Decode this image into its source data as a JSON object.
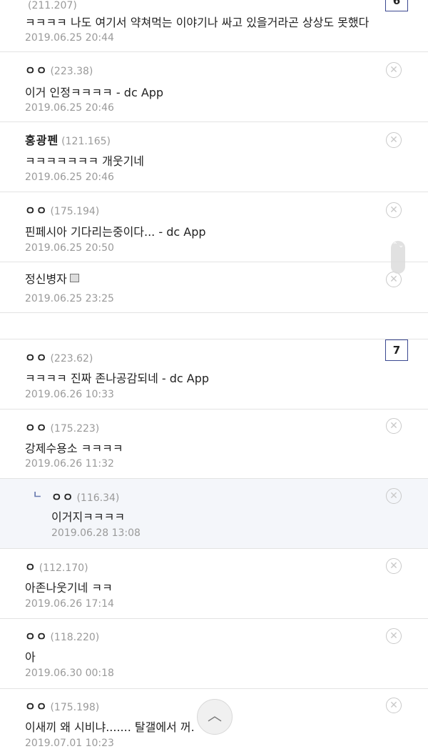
{
  "top_partial": {
    "ip": "(211.207)",
    "text": "ㅋㅋㅋㅋ 나도 여기서 약쳐먹는 이야기나 싸고 있을거라곤 상상도 못했다",
    "date": "2019.06.25 20:44",
    "page_badge": "6"
  },
  "comments": [
    {
      "nick": "ㅇㅇ",
      "ip": "(223.38)",
      "text": "이거 인정ㅋㅋㅋㅋ - dc App",
      "date": "2019.06.25 20:46"
    },
    {
      "nick": "홍광펜",
      "ip": "(121.165)",
      "text": "ㅋㅋㅋㅋㅋㅋㅋ 개웃기네",
      "date": "2019.06.25 20:46"
    },
    {
      "nick": "ㅇㅇ",
      "ip": "(175.194)",
      "text": "핀페시아 기다리는중이다... - dc App",
      "date": "2019.06.25 20:50"
    },
    {
      "nick": "정신병자",
      "ip": "",
      "text": "",
      "date": "2019.06.25 23:25"
    }
  ],
  "page_badge_2": "7",
  "comments2": [
    {
      "nick": "ㅇㅇ",
      "ip": "(223.62)",
      "text": "ㅋㅋㅋㅋ 진짜 존나공감되네 - dc App",
      "date": "2019.06.26 10:33"
    },
    {
      "nick": "ㅇㅇ",
      "ip": "(175.223)",
      "text": "강제수용소 ㅋㅋㅋㅋ",
      "date": "2019.06.26 11:32"
    },
    {
      "nick": "ㅇㅇ",
      "ip": "(116.34)",
      "text": "이거지ㅋㅋㅋㅋ",
      "date": "2019.06.28 13:08",
      "reply_mark": "ㄴ"
    },
    {
      "nick": "ㅇ",
      "ip": "(112.170)",
      "text": "아존나웃기네 ㅋㅋ",
      "date": "2019.06.26 17:14"
    },
    {
      "nick": "ㅇㅇ",
      "ip": "(118.220)",
      "text": "아",
      "date": "2019.06.30 00:18"
    },
    {
      "nick": "ㅇㅇ",
      "ip": "(175.198)",
      "text": "이새끼 왜 시비냐....... 탈갤에서 꺼.",
      "date": "2019.07.01 10:23"
    }
  ],
  "icons": {
    "delete": "close-circle-icon",
    "top": "chevron-up-icon",
    "memo": "memo-icon"
  },
  "glyphs": {
    "delete": "✕",
    "top": "︿",
    "scroll": "⌃⌄"
  }
}
